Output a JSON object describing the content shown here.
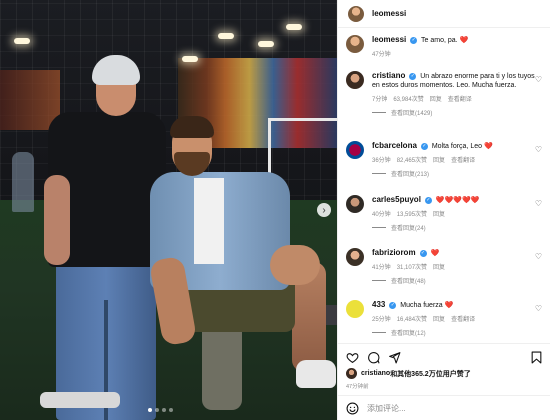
{
  "post": {
    "author": "leomessi",
    "caption": "Te amo, pa. ❤️",
    "caption_time": "47分钟"
  },
  "comments": [
    {
      "user": "cristiano",
      "verified": true,
      "text": "Un abrazo enorme para ti y los tuyos en estos duros momentos. Leo. Mucha fuerza.",
      "time": "7分钟",
      "likes": "63,984次赞",
      "reply": "回复",
      "menu": "查看翻译",
      "view_replies": "查看回复(1429)"
    },
    {
      "user": "fcbarcelona",
      "verified": true,
      "text": "Molta força, Leo ❤️",
      "time": "36分钟",
      "likes": "82,465次赞",
      "reply": "回复",
      "menu": "查看翻译",
      "view_replies": "查看回复(213)"
    },
    {
      "user": "carles5puyol",
      "verified": true,
      "text": "❤️❤️❤️❤️❤️",
      "time": "40分钟",
      "likes": "13,595次赞",
      "reply": "回复",
      "menu": "",
      "view_replies": "查看回复(24)"
    },
    {
      "user": "fabriziorom",
      "verified": true,
      "text": "❤️",
      "time": "41分钟",
      "likes": "31,107次赞",
      "reply": "回复",
      "menu": "",
      "view_replies": "查看回复(48)"
    },
    {
      "user": "433",
      "verified": true,
      "text": "Mucha fuerza ❤️",
      "time": "25分钟",
      "likes": "16,484次赞",
      "reply": "回复",
      "menu": "查看翻译",
      "view_replies": "查看回复(12)"
    }
  ],
  "likes_text_user": "cristiano",
  "likes_text_rest": "和其他365.2万位用户赞了",
  "timestamp": "47分钟前",
  "add_comment_placeholder": "添加评论...",
  "icons": [
    "heart-icon",
    "comment-icon",
    "share-icon",
    "bookmark-icon",
    "emoji-icon"
  ],
  "colors": {
    "verified": "#3897f0",
    "heart_red": "#ed4956"
  }
}
